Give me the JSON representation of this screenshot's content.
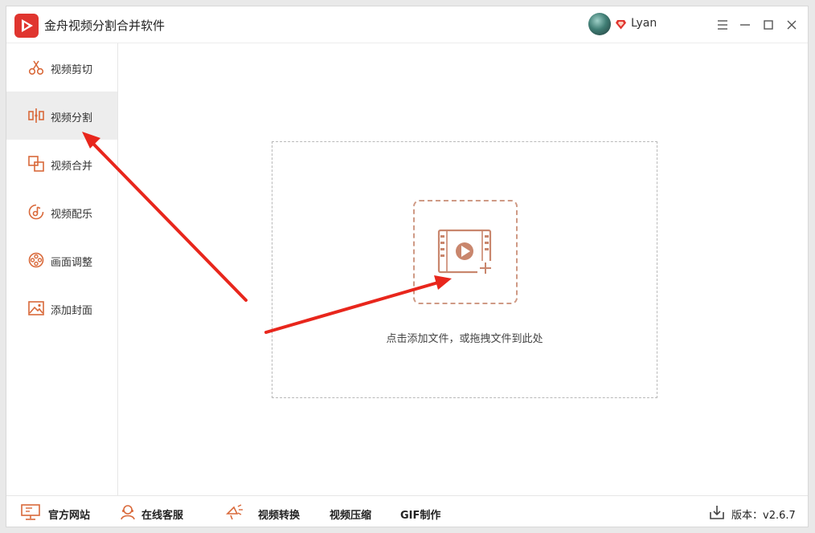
{
  "app": {
    "title": "金舟视频分割合并软件",
    "accent": "#d9693a",
    "logo_color": "#e0352f"
  },
  "user": {
    "name": "Lyan"
  },
  "sidebar": {
    "items": [
      {
        "label": "视频剪切",
        "icon": "scissors-icon"
      },
      {
        "label": "视频分割",
        "icon": "split-icon",
        "active": true
      },
      {
        "label": "视频合并",
        "icon": "merge-icon"
      },
      {
        "label": "视频配乐",
        "icon": "music-icon"
      },
      {
        "label": "画面调整",
        "icon": "film-reel-icon"
      },
      {
        "label": "添加封面",
        "icon": "image-icon"
      }
    ]
  },
  "main": {
    "drop_hint": "点击添加文件，或拖拽文件到此处"
  },
  "footer": {
    "official_site": "官方网站",
    "online_service": "在线客服",
    "video_convert": "视频转换",
    "video_compress": "视频压缩",
    "gif_make": "GIF制作",
    "version": "版本：v2.6.7"
  }
}
